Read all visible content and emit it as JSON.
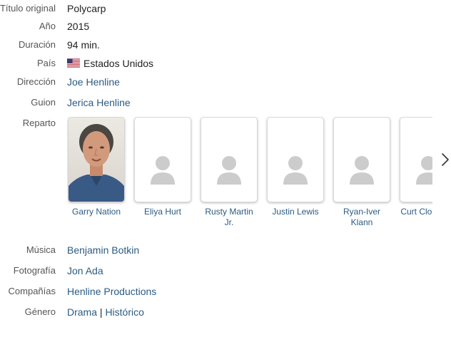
{
  "details": {
    "original_title": {
      "label": "Título original",
      "value": "Polycarp"
    },
    "year": {
      "label": "Año",
      "value": "2015"
    },
    "duration": {
      "label": "Duración",
      "value": "94 min."
    },
    "country": {
      "label": "País",
      "flag_icon": "us-flag-icon",
      "value": "Estados Unidos"
    },
    "director": {
      "label": "Dirección",
      "value": "Joe Henline"
    },
    "screenplay": {
      "label": "Guion",
      "value": "Jerica Henline"
    },
    "cast": {
      "label": "Reparto",
      "members": [
        {
          "name": "Garry Nation",
          "has_photo": true
        },
        {
          "name": "Eliya Hurt",
          "has_photo": false
        },
        {
          "name": "Rusty Martin Jr.",
          "has_photo": false
        },
        {
          "name": "Justin Lewis",
          "has_photo": false
        },
        {
          "name": "Ryan-Iver Klann",
          "has_photo": false
        },
        {
          "name": "Curt Cloninger",
          "has_photo": false
        }
      ],
      "next_icon": "chevron-right-icon"
    },
    "music": {
      "label": "Música",
      "value": "Benjamin Botkin"
    },
    "photography": {
      "label": "Fotografía",
      "value": "Jon Ada"
    },
    "companies": {
      "label": "Compañías",
      "value": "Henline Productions"
    },
    "genre": {
      "label": "Género",
      "values": [
        "Drama",
        "Histórico"
      ],
      "separator": "|"
    }
  },
  "colors": {
    "link": "#2b5b84",
    "label": "#555555",
    "placeholder_avatar": "#cccccc"
  }
}
